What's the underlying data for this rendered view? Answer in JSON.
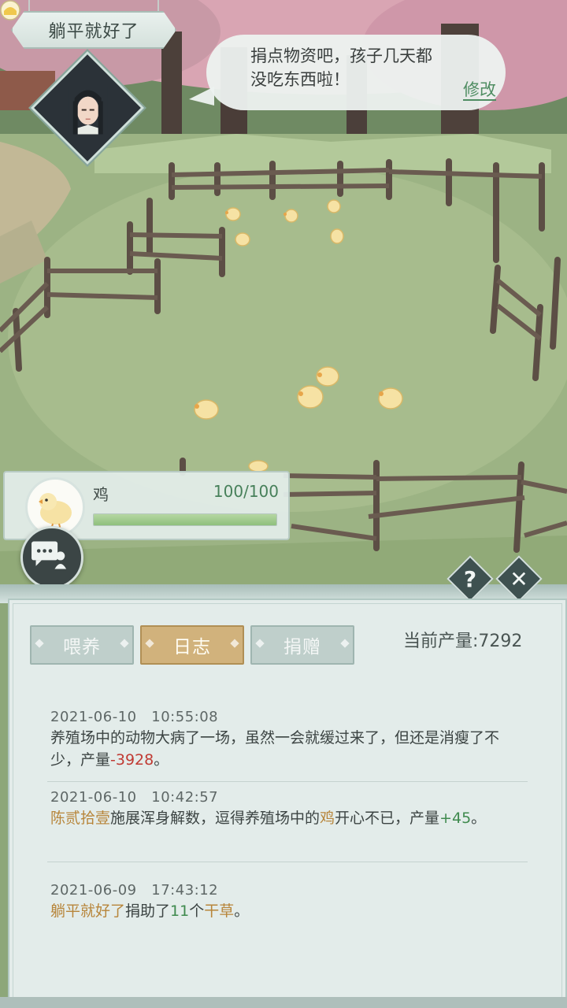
{
  "header": {
    "player_name": "躺平就好了"
  },
  "speech": {
    "line1": "捐点物资吧，孩子几天都",
    "line2": "没吃东西啦！",
    "edit_label": "修改"
  },
  "animal": {
    "name": "鸡",
    "hp_text": "100/100",
    "hp_fraction": 1.0
  },
  "tabs": [
    {
      "label": "喂养",
      "active": false
    },
    {
      "label": "日志",
      "active": true
    },
    {
      "label": "捐赠",
      "active": false
    }
  ],
  "output": {
    "label": "当前产量:",
    "value": "7292"
  },
  "log": [
    {
      "time": "2021-06-10   10:55:08",
      "text_a": "养殖场中的动物大病了一场，虽然一会就缓过来了，但还是消瘦了不少，产量",
      "highlight": "-3928",
      "text_b": "。"
    },
    {
      "time": "2021-06-10   10:42:57",
      "actor": "陈贰拾壹",
      "text_a": "施展浑身解数，逗得养殖场中的",
      "animal": "鸡",
      "text_b": "开心不已，产量",
      "highlight": "+45",
      "text_c": "。"
    },
    {
      "time": "2021-06-09   17:43:12",
      "actor": "躺平就好了",
      "text_a": "捐助了",
      "count": "11",
      "text_b": "个",
      "item": "干草",
      "text_c": "。"
    }
  ],
  "colors": {
    "negative": "#c03a33",
    "name": "#b7853a",
    "positive": "#3f8a4e",
    "active_tab": "#d1b27c"
  }
}
